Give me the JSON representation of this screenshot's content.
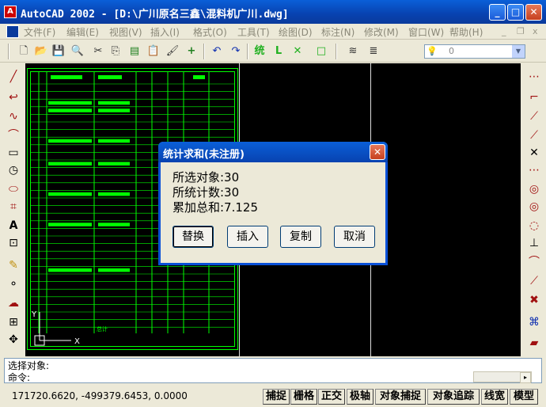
{
  "window": {
    "app_icon": "A",
    "title": "AutoCAD 2002 - [D:\\广川原名三鑫\\混料机广川.dwg]",
    "minimize": "_",
    "maximize": "□",
    "close": "✕"
  },
  "menu": {
    "items": [
      "文件(F)",
      "编辑(E)",
      "视图(V)",
      "插入(I)",
      "格式(O)",
      "工具(T)",
      "绘图(D)",
      "标注(N)",
      "修改(M)",
      "窗口(W)",
      "帮助(H)"
    ],
    "mdi_minimize": "_",
    "mdi_restore": "❐",
    "mdi_close": "x"
  },
  "toolbar": {
    "layer_value": "0"
  },
  "dialog": {
    "title": "统计求和(未注册)",
    "close": "✕",
    "selected_objects": "所选对象:30",
    "counted": "所统计数:30",
    "sum": "累加总和:7.125",
    "buttons": {
      "replace": "替换",
      "insert": "插入",
      "copy": "复制",
      "cancel": "取消"
    }
  },
  "command": {
    "line1": "选择对象:",
    "line2": "命令:"
  },
  "status": {
    "coords": "171720.6620, -499379.6453, 0.0000",
    "snap": "捕捉",
    "grid": "栅格",
    "ortho": "正交",
    "polar": "极轴",
    "osnap": "对象捕捉",
    "otrack": "对象追踪",
    "lwt": "线宽",
    "model": "模型"
  },
  "drawing": {
    "axis_x": "X",
    "axis_y": "Y",
    "table_bottom_label": "总计"
  },
  "colors": {
    "title_blue": "#0a50d8",
    "cad_green": "#00ff00",
    "cad_background": "#000000"
  }
}
